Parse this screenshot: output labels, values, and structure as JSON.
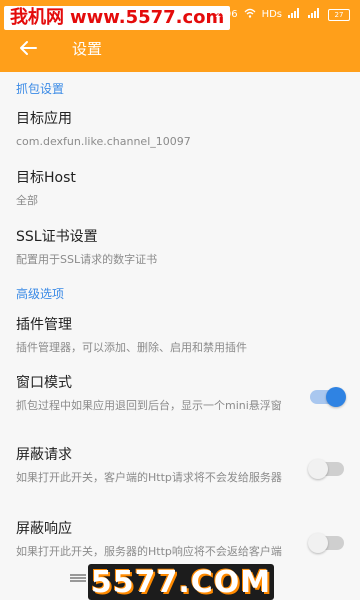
{
  "watermark": {
    "site": "我机网",
    "url": "www.5577.com"
  },
  "status_bar": {
    "time": "2:06",
    "network": "HDs",
    "battery": "27"
  },
  "appbar": {
    "title": "设置"
  },
  "sections": [
    {
      "header": "抓包设置"
    },
    {
      "header": "高级选项"
    }
  ],
  "items": [
    {
      "title": "目标应用",
      "subtitle": "com.dexfun.like.channel_10097"
    },
    {
      "title": "目标Host",
      "subtitle": "全部"
    },
    {
      "title": "SSL证书设置",
      "subtitle": "配置用于SSL请求的数字证书"
    },
    {
      "title": "插件管理",
      "subtitle": "插件管理器，可以添加、删除、启用和禁用插件"
    },
    {
      "title": "窗口模式",
      "subtitle": "抓包过程中如果应用退回到后台，显示一个mini悬浮窗",
      "toggle": true
    },
    {
      "title": "屏蔽请求",
      "subtitle": "如果打开此开关，客户端的Http请求将不会发给服务器",
      "toggle": false
    },
    {
      "title": "屏蔽响应",
      "subtitle": "如果打开此开关，服务器的Http响应将不会返给客户端",
      "toggle": false
    }
  ],
  "footer_watermark": "5577.COM",
  "colors": {
    "primary": "#ff9f1a",
    "accent": "#2f83e3",
    "section": "#3a8ae6"
  }
}
